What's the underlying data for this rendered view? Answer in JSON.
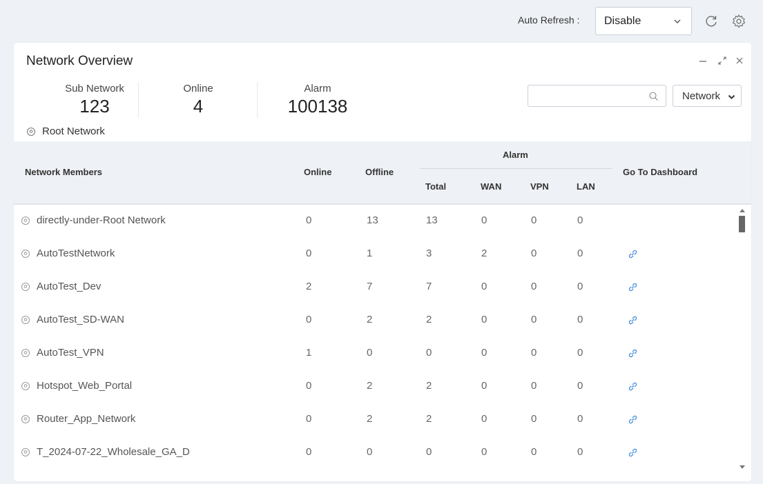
{
  "toolbar": {
    "auto_refresh_label": "Auto Refresh :",
    "auto_refresh_value": "Disable",
    "refresh_icon": "refresh-icon",
    "settings_icon": "gear-icon"
  },
  "panel": {
    "title": "Network Overview",
    "stats": {
      "sub_network_label": "Sub Network",
      "sub_network_value": "123",
      "online_label": "Online",
      "online_value": "4",
      "alarm_label": "Alarm",
      "alarm_value": "100138"
    },
    "root_network": "Root Network",
    "search_placeholder": "",
    "filter_value": "Network"
  },
  "table": {
    "headers": {
      "members": "Network Members",
      "online": "Online",
      "offline": "Offline",
      "alarm": "Alarm",
      "total": "Total",
      "wan": "WAN",
      "vpn": "VPN",
      "lan": "LAN",
      "dashboard": "Go To Dashboard"
    },
    "rows": [
      {
        "name": "directly-under-Root Network",
        "online": "0",
        "offline": "13",
        "total": "13",
        "wan": "0",
        "vpn": "0",
        "lan": "0",
        "link": false
      },
      {
        "name": "AutoTestNetwork",
        "online": "0",
        "offline": "1",
        "total": "3",
        "wan": "2",
        "vpn": "0",
        "lan": "0",
        "link": true
      },
      {
        "name": "AutoTest_Dev",
        "online": "2",
        "offline": "7",
        "total": "7",
        "wan": "0",
        "vpn": "0",
        "lan": "0",
        "link": true
      },
      {
        "name": "AutoTest_SD-WAN",
        "online": "0",
        "offline": "2",
        "total": "2",
        "wan": "0",
        "vpn": "0",
        "lan": "0",
        "link": true
      },
      {
        "name": "AutoTest_VPN",
        "online": "1",
        "offline": "0",
        "total": "0",
        "wan": "0",
        "vpn": "0",
        "lan": "0",
        "link": true
      },
      {
        "name": "Hotspot_Web_Portal",
        "online": "0",
        "offline": "2",
        "total": "2",
        "wan": "0",
        "vpn": "0",
        "lan": "0",
        "link": true
      },
      {
        "name": "Router_App_Network",
        "online": "0",
        "offline": "2",
        "total": "2",
        "wan": "0",
        "vpn": "0",
        "lan": "0",
        "link": true
      },
      {
        "name": "T_2024-07-22_Wholesale_GA_D",
        "online": "0",
        "offline": "0",
        "total": "0",
        "wan": "0",
        "vpn": "0",
        "lan": "0",
        "link": true
      }
    ]
  },
  "colors": {
    "background": "#eef1f5",
    "panel": "#ffffff",
    "link": "#4a90d9"
  }
}
